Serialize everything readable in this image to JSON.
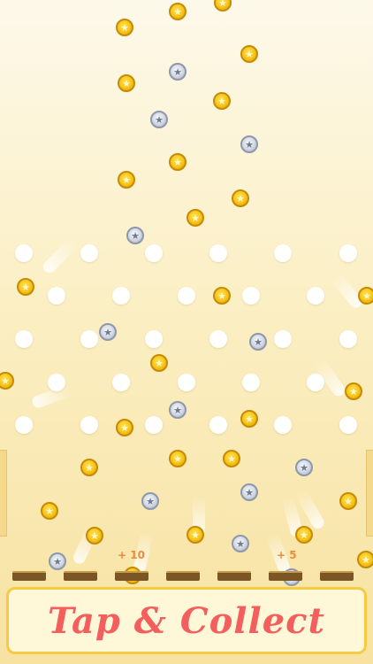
{
  "game": {
    "cta_text": "Tap & Collect",
    "bonus_labels": [
      "+ 10",
      "+ 5"
    ],
    "star_glyph": "★",
    "colors": {
      "background_top": "#fdf9ea",
      "background_bottom": "#f7e2a1",
      "banner_text": "#f25f5c",
      "banner_border": "#f6ca45",
      "bonus_text": "#f08a3a",
      "gold_coin": "#f6c418",
      "silver_coin": "#d2d7e2",
      "peg": "#ffffff",
      "slot": "#7a5624"
    },
    "icons": [
      "gold-coin-icon",
      "silver-coin-icon",
      "peg"
    ]
  }
}
